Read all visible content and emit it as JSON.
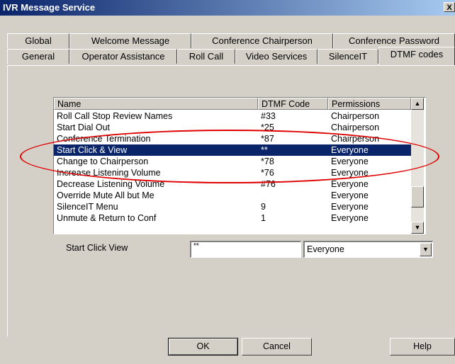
{
  "window": {
    "title": "IVR Message Service",
    "close_label": "X"
  },
  "tabs_row1": [
    {
      "label": "Global"
    },
    {
      "label": "Welcome Message"
    },
    {
      "label": "Conference Chairperson"
    },
    {
      "label": "Conference Password"
    }
  ],
  "tabs_row2": [
    {
      "label": "General"
    },
    {
      "label": "Operator Assistance"
    },
    {
      "label": "Roll Call"
    },
    {
      "label": "Video Services"
    },
    {
      "label": "SilenceIT"
    },
    {
      "label": "DTMF codes"
    }
  ],
  "table": {
    "columns": [
      "Name",
      "DTMF Code",
      "Permissions"
    ],
    "rows": [
      {
        "name": "Roll Call Stop Review Names",
        "code": "#33",
        "perm": "Chairperson"
      },
      {
        "name": "Start Dial Out",
        "code": "*25",
        "perm": "Chairperson"
      },
      {
        "name": "Conference Termination",
        "code": "*87",
        "perm": "Chairperson"
      },
      {
        "name": "Start Click & View",
        "code": "**",
        "perm": "Everyone"
      },
      {
        "name": "Change to Chairperson",
        "code": "*78",
        "perm": "Everyone"
      },
      {
        "name": "Increase Listening Volume",
        "code": "*76",
        "perm": "Everyone"
      },
      {
        "name": "Decrease Listening Volume",
        "code": "#76",
        "perm": "Everyone"
      },
      {
        "name": "Override Mute All but Me",
        "code": "",
        "perm": "Everyone"
      },
      {
        "name": "SilenceIT Menu",
        "code": "9",
        "perm": "Everyone"
      },
      {
        "name": "Unmute & Return to Conf",
        "code": "1",
        "perm": "Everyone"
      }
    ],
    "selected_index": 3
  },
  "editor": {
    "label": "Start Click  View",
    "code_value": "**",
    "permission_value": "Everyone"
  },
  "buttons": {
    "ok": "OK",
    "cancel": "Cancel",
    "help": "Help"
  },
  "colors": {
    "title_bar": "#0a246a",
    "selection": "#0a246a",
    "highlight_oval": "#e00000",
    "dialog_bg": "#d4d0c8"
  }
}
